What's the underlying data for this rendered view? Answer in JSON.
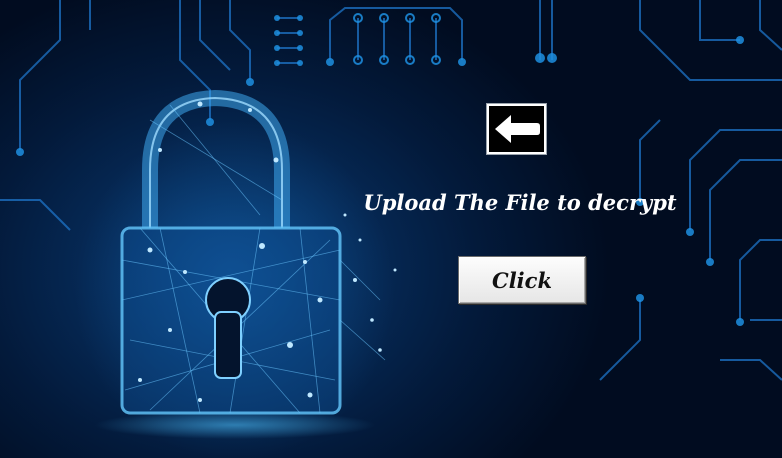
{
  "upload": {
    "label": "Upload The File to decrypt"
  },
  "click_button": {
    "label": "Click"
  },
  "icons": {
    "back": "left-arrow-icon",
    "illustration": "padlock-icon"
  },
  "colors": {
    "background": "#02122b",
    "accent": "#1e8fe0"
  }
}
